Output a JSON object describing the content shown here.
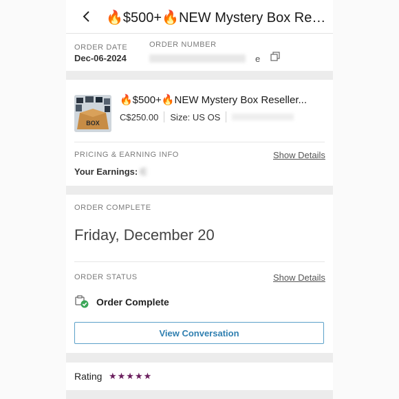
{
  "header": {
    "title": "🔥$500+🔥NEW Mystery Box Res..."
  },
  "order": {
    "date_label": "ORDER DATE",
    "date_value": "Dec-06-2024",
    "number_label": "ORDER NUMBER",
    "number_value_blurred": "e"
  },
  "item": {
    "title": "🔥$500+🔥NEW Mystery Box Reseller...",
    "price": "C$250.00",
    "size": "Size: US OS",
    "thumb_text": "BOX"
  },
  "pricing": {
    "label": "PRICING & EARNING INFO",
    "show_details": "Show Details",
    "earnings_label": "Your Earnings:",
    "earnings_value_blurred": "C"
  },
  "completion": {
    "label": "ORDER COMPLETE",
    "date": "Friday, December 20",
    "status_label": "ORDER STATUS",
    "status_show_details": "Show Details",
    "status_text": "Order Complete",
    "button": "View Conversation"
  },
  "rating": {
    "label": "Rating",
    "stars": "★★★★★"
  },
  "colors": {
    "accent_link_blue": "#2f7fb0",
    "star_purple": "#6b1f5e",
    "check_green": "#3aa757"
  }
}
